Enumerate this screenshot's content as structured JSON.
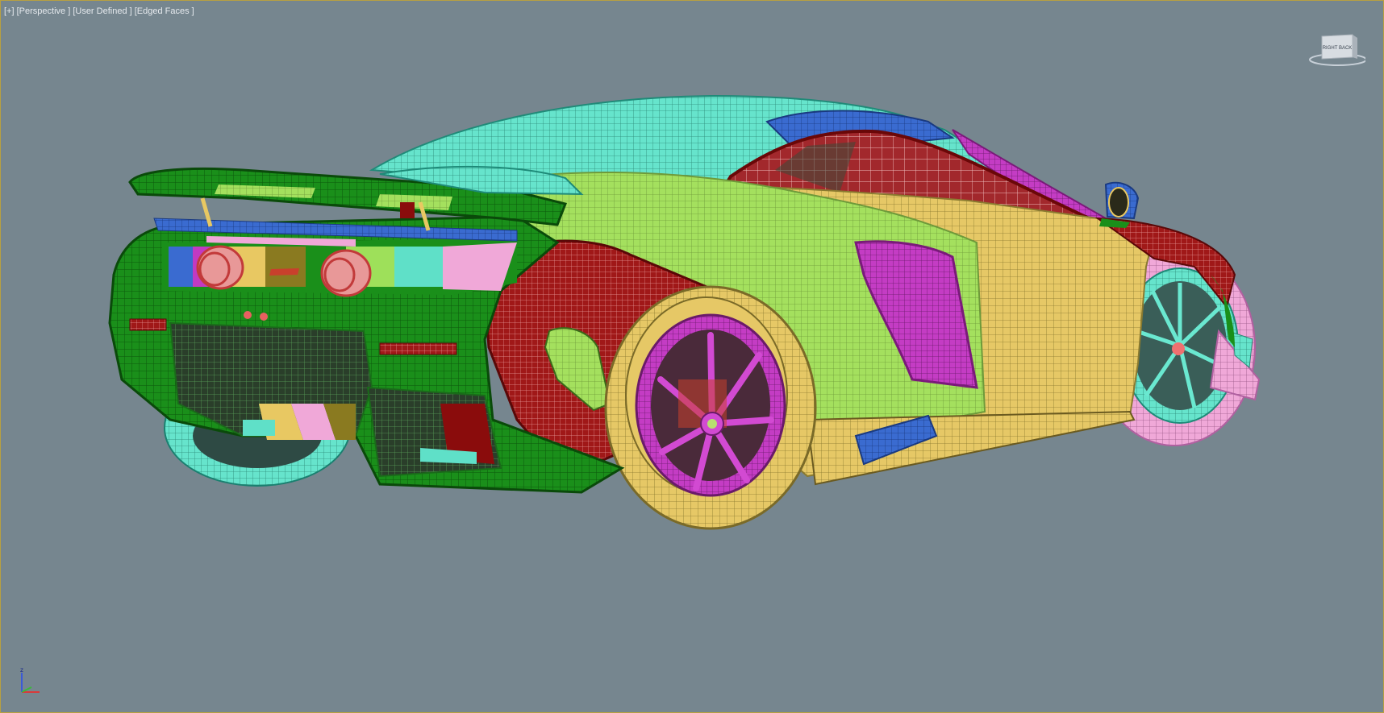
{
  "viewport": {
    "labels": [
      {
        "text": "[+]",
        "name": "viewport-menu-label"
      },
      {
        "text": "[Perspective ]",
        "name": "point-of-view-label"
      },
      {
        "text": "[User Defined ]",
        "name": "shading-style-label"
      },
      {
        "text": "[Edged Faces ]",
        "name": "display-mode-label"
      }
    ],
    "viewcube_label": "RIGHT   BACK",
    "axis_label": "z"
  },
  "colors": {
    "background": "#76868f",
    "green_dark": "#138a13",
    "green_light": "#9ee05a",
    "cyan": "#5fe0c8",
    "yellow": "#e8c862",
    "magenta": "#c23ac2",
    "pink": "#f0a8d8",
    "dark_red": "#8a0c0c",
    "blue": "#3a6bd0",
    "salmon": "#e8706c"
  }
}
